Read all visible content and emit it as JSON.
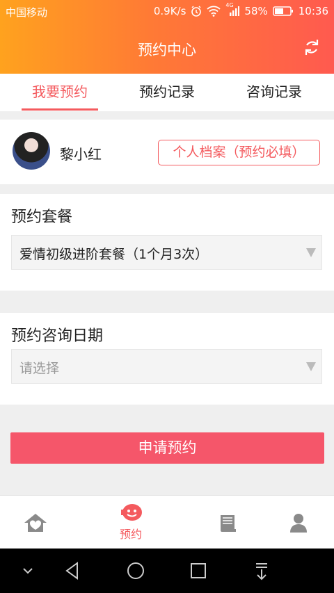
{
  "status_bar": {
    "carrier": "中国移动",
    "speed": "0.9K/s",
    "network_type": "4G",
    "battery": "58%",
    "time": "10:36"
  },
  "header": {
    "title": "预约中心",
    "refresh_icon": "refresh-icon"
  },
  "tabs": [
    {
      "label": "我要预约",
      "active": true
    },
    {
      "label": "预约记录",
      "active": false
    },
    {
      "label": "咨询记录",
      "active": false
    }
  ],
  "user": {
    "name": "黎小红",
    "profile_button": "个人档案（预约必填）"
  },
  "package": {
    "label": "预约套餐",
    "value": "爱情初级进阶套餐（1个月3次）"
  },
  "date": {
    "label": "预约咨询日期",
    "placeholder": "请选择"
  },
  "submit_label": "申请预约",
  "bottom_nav": [
    {
      "icon": "home-icon",
      "label": "",
      "active": false
    },
    {
      "icon": "smile-chat-icon",
      "label": "预约",
      "active": true
    },
    {
      "icon": "book-icon",
      "label": "",
      "active": false
    },
    {
      "icon": "user-icon",
      "label": "",
      "active": false
    }
  ],
  "colors": {
    "accent": "#f45a5e",
    "button": "#f5566a",
    "header_start": "#ffa21e",
    "header_end": "#ff5a4f",
    "nav_icon": "#8a8a8a"
  }
}
